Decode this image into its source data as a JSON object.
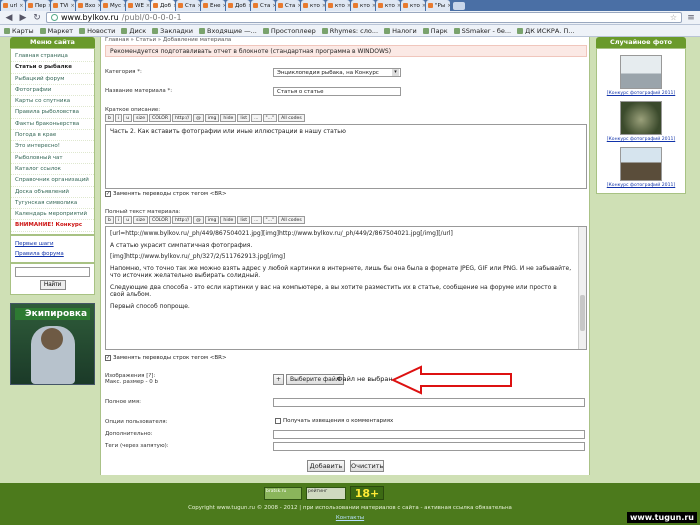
{
  "browser": {
    "tabs": [
      "url",
      "Пер",
      "TVi",
      "Вхо",
      "Мус",
      "WE",
      "Доб",
      "Ста",
      "Ене",
      "Доб",
      "Ста",
      "Ста",
      "кто",
      "кто",
      "кто",
      "кто",
      "кто",
      "\"Ры"
    ],
    "active_tab_index": 6,
    "url_host": "www.bylkov.ru",
    "url_path": "/publ/0-0-0-0-1",
    "bookmarks": [
      "Карты",
      "Маркет",
      "Новости",
      "Диск",
      "Закладки",
      "Входящие —...",
      "Простоплеер",
      "Rhymes: сло...",
      "Налоги",
      "Парк",
      "SSmaker - бе...",
      "ДК ИСКРА. П..."
    ]
  },
  "sidebar": {
    "title": "Меню сайта",
    "items": [
      "Главная страница",
      "Статьи о рыбалке",
      "Рыбацкий форум",
      "Фотографии",
      "Карты со спутника",
      "Правила рыболовства",
      "Факты браконьерства",
      "Погода в крае",
      "Это интересно!",
      "Рыболовный чат",
      "Каталог ссылок",
      "Справочник организаций",
      "Доска объявлений",
      "Тугунская символика",
      "Календарь мероприятий",
      "ВНИМАНИЕ! Конкурс"
    ],
    "active_index": 1,
    "links": [
      "Первые шаги",
      "Правила форума"
    ],
    "search_button": "Найти",
    "ad_title": "Экипировка"
  },
  "right": {
    "title": "Случайное фото",
    "captions": [
      "[Конкурс фотографий 2011]",
      "[Конкурс фотографий 2011]",
      "[Конкурс фотографий 2011]"
    ]
  },
  "form": {
    "breadcrumb": "Главная » Статьи » Добавление материала",
    "notice": "Рекомендуется подготавливать отчет в блокноте (стандартная программа в WINDOWS)",
    "category_label": "Категория *:",
    "category_value": "Энциклопедия рыбака, на Конкурс",
    "title_label": "Название материала *:",
    "title_value": "Статья о статье",
    "brief_label": "Краткое описание:",
    "toolbar": [
      "b",
      "i",
      "u",
      "size",
      "COLOR",
      "http://",
      "@",
      "img",
      "hide",
      "list",
      "...",
      "\"...\"",
      "All codes"
    ],
    "brief_text": "Часть 2. Как вставить фотографии или иные иллюстрации в нашу статью",
    "convert_label": "Заменять переводы строк тегом <BR>",
    "full_label": "Полный текст материала:",
    "full_text": [
      "[url=http://www.bylkov.ru/_ph/449/867504021.jpg][img]http://www.bylkov.ru/_ph/449/2/867504021.jpg[/img][/url]",
      "А статью украсит симпатичная фотография.",
      "[img]http://www.bylkov.ru/_ph/327/2/511762913.jpg[/img]",
      "Напомню, что точно так же можно взять адрес у любой картинки в интернете, лишь бы она была в формате JPEG, GIF или PNG. И не забывайте, что источник желательно выбирать солидный.",
      "Следующие два способа - это если картинки у вас на компьютере, а вы хотите разместить их в статье, сообщение на форуме или просто  в свой альбом.",
      "Первый способ попроще."
    ],
    "image_label": "Изображения [?]:",
    "image_max": "Макс. размер - 0 b",
    "file_button": "Выберите файл",
    "file_status": "Файл не выбран",
    "fullname_label": "Полное имя:",
    "options_label": "Опции пользователя:",
    "notify_label": "Получать извещения о комментариях",
    "extra_label": "Дополнительно:",
    "tags_label": "Теги (через запятую):",
    "submit": "Добавить",
    "reset": "Очистить"
  },
  "footer": {
    "counters": [
      "bratsk.ru",
      "рейтинг",
      "18+"
    ],
    "copyright": "Copyright www.tugun.ru © 2008 - 2012 | при использовании материалов с сайта - активная ссылка обязательна",
    "contacts": "Контакты",
    "watermark": "www.tugun.ru"
  }
}
